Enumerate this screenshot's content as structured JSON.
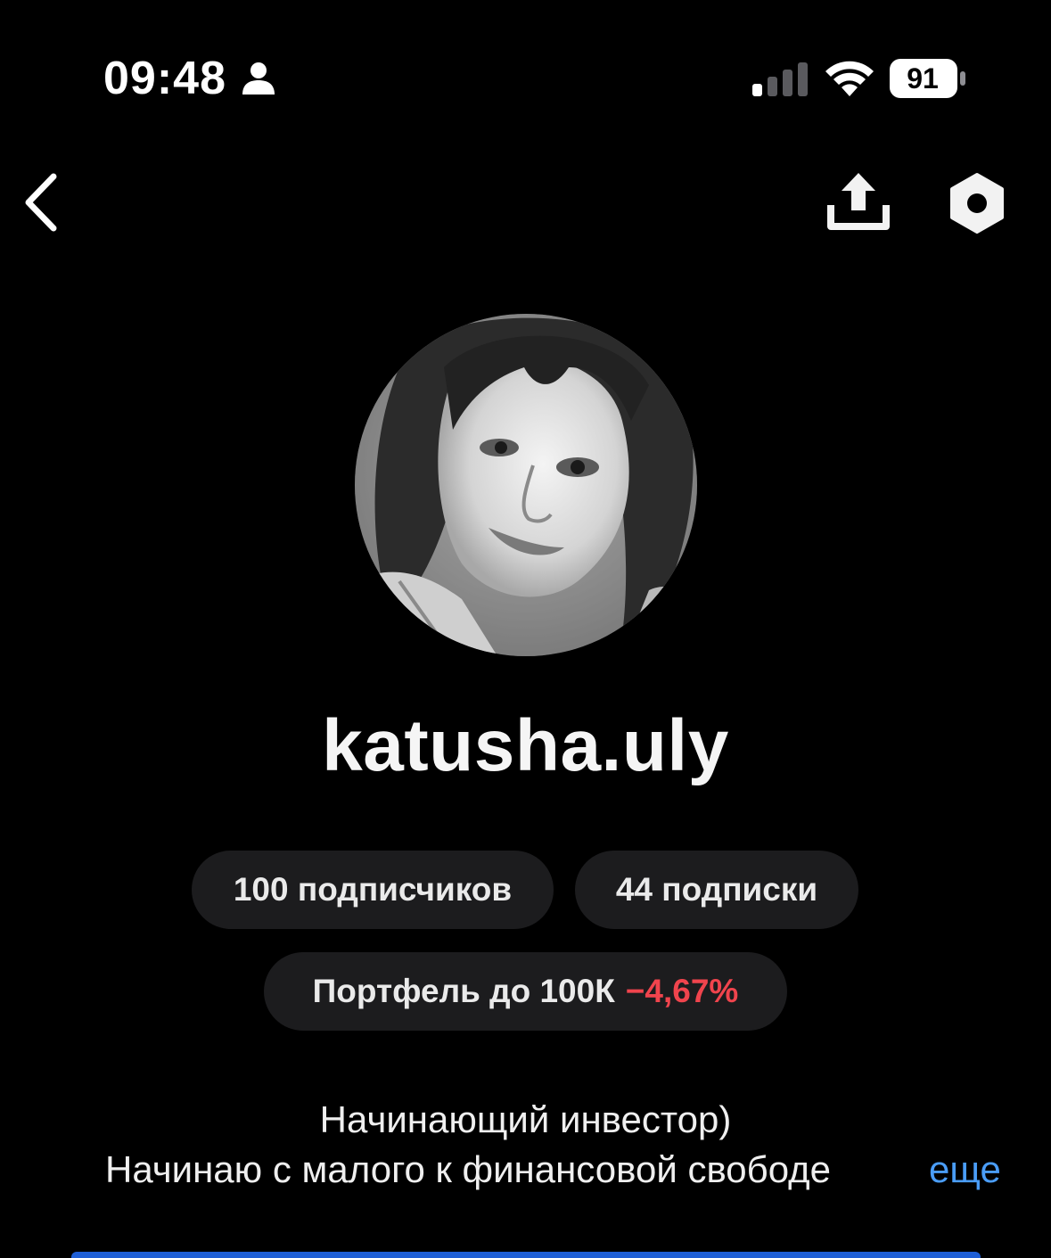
{
  "status_bar": {
    "time": "09:48",
    "battery_level": "91",
    "icons": [
      "person-icon",
      "signal-icon",
      "wifi-icon",
      "battery-icon"
    ]
  },
  "nav": {
    "icons": [
      "back-chevron-icon",
      "share-icon",
      "settings-icon"
    ]
  },
  "profile": {
    "username": "katusha.uly",
    "followers_label": "100 подписчиков",
    "following_label": "44 подписки",
    "portfolio": {
      "name": "Портфель до 100К",
      "change": "−4,67%",
      "change_color": "#f0444d"
    },
    "bio": {
      "line1": "Начинающий инвестор)",
      "line2": "Начинаю с малого к финансовой свободе",
      "more_label": "еще"
    }
  },
  "colors": {
    "background": "#000000",
    "pill_background": "#1c1c1e",
    "link": "#4a9df8",
    "negative": "#f0444d"
  }
}
